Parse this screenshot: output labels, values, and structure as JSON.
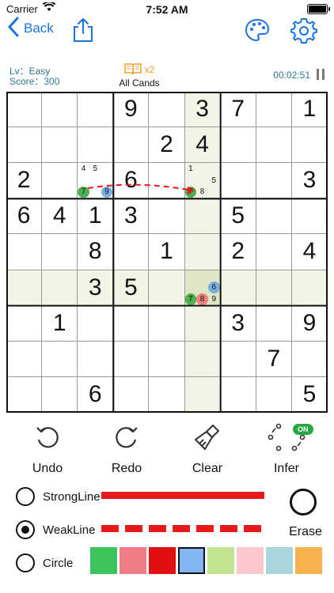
{
  "status": {
    "carrier": "Carrier",
    "time": "7:52 AM"
  },
  "nav": {
    "back_label": "Back"
  },
  "info": {
    "level": "Lv：Easy",
    "score": "Score：300",
    "multiplier": "x2",
    "cands_label": "All Cands",
    "timer": "00:02:51"
  },
  "board": {
    "rows": [
      [
        "",
        "",
        "",
        "9",
        "",
        "3",
        "7",
        "",
        "1"
      ],
      [
        "",
        "",
        "",
        "",
        "2",
        "4",
        "",
        "",
        ""
      ],
      [
        "2",
        "",
        "",
        "6",
        "",
        "",
        "",
        "",
        "3"
      ],
      [
        "6",
        "4",
        "1",
        "3",
        "",
        "",
        "5",
        "",
        ""
      ],
      [
        "",
        "",
        "8",
        "",
        "1",
        "",
        "2",
        "",
        "4"
      ],
      [
        "",
        "",
        "3",
        "5",
        "",
        "",
        "",
        "",
        ""
      ],
      [
        "",
        "1",
        "",
        "",
        "",
        "",
        "3",
        "",
        "9"
      ],
      [
        "",
        "",
        "",
        "",
        "",
        "",
        "",
        "7",
        ""
      ],
      [
        "",
        "",
        "6",
        "",
        "",
        "",
        "",
        "",
        "5"
      ]
    ],
    "candidates": [
      {
        "row": 2,
        "col": 2,
        "cands": [
          {
            "d": "4",
            "pos": 0
          },
          {
            "d": "5",
            "pos": 1
          },
          {
            "d": "7",
            "pos": 6,
            "color": "#4caf50"
          },
          {
            "d": "9",
            "pos": 8,
            "color": "#7aaee0"
          }
        ]
      },
      {
        "row": 2,
        "col": 5,
        "cands": [
          {
            "d": "1",
            "pos": 0
          },
          {
            "d": "5",
            "pos": 5
          },
          {
            "d": "7",
            "pos": 6,
            "color": "#4caf50"
          },
          {
            "d": "8",
            "pos": 7
          }
        ]
      },
      {
        "row": 5,
        "col": 5,
        "cands": [
          {
            "d": "6",
            "pos": 5,
            "color": "#7aaee0"
          },
          {
            "d": "7",
            "pos": 6,
            "color": "#4caf50"
          },
          {
            "d": "8",
            "pos": 7,
            "color": "#f08080"
          },
          {
            "d": "9",
            "pos": 8
          }
        ]
      }
    ],
    "highlight_row": 5,
    "highlight_col": 5
  },
  "tools": [
    {
      "label": "Undo",
      "icon": "undo-icon"
    },
    {
      "label": "Redo",
      "icon": "redo-icon"
    },
    {
      "label": "Clear",
      "icon": "broom-icon"
    },
    {
      "label": "Infer",
      "icon": "infer-icon",
      "badge": "ON"
    }
  ],
  "options": {
    "strong": "StrongLine",
    "weak": "WeakLine",
    "circle": "Circle",
    "erase": "Erase",
    "selected": "WeakLine",
    "line_color": "#e51b1b"
  },
  "palette": [
    "#3cc35c",
    "#f07a86",
    "#e01010",
    "#82b6f2",
    "#bfe38e",
    "#fbc8cc",
    "#a9d6dc",
    "#f5b24e"
  ],
  "palette_selected": 3
}
